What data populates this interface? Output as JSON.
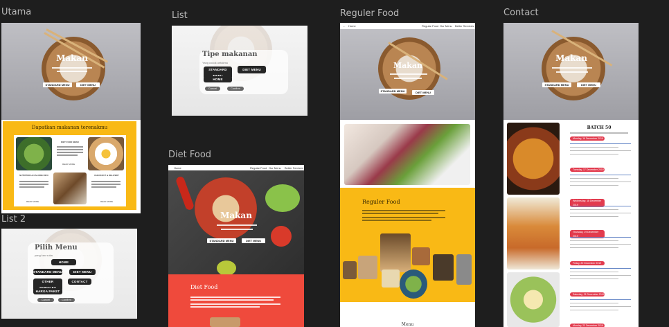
{
  "labels": {
    "utama": "Utama",
    "list": "List",
    "reguler": "Reguler Food",
    "contact": "Contact",
    "diet": "Diet Food",
    "list2": "List 2"
  },
  "hero": {
    "title": "Makan",
    "btn_standard": "STANDARD MENU",
    "btn_diet": "DIET MENU"
  },
  "utama": {
    "banner": "Dapatkan makanan terenakmu",
    "card_titles": [
      "DIET FOOD MENU",
      "NUTRITION & CALORIE INFO",
      "CHECKOUT & DELIVERY"
    ],
    "read_more": "READ MORE"
  },
  "list": {
    "title": "Tipe makanan",
    "subtitle": "Yang cocok untukmu",
    "btn_standard": "STANDARD MENU",
    "btn_diet": "DIET MENU",
    "btn_home": "HOME",
    "cancel": "Cancel",
    "confirm": "Confirm"
  },
  "list2": {
    "title": "Pilih Menu",
    "subtitle": "yang kau suka",
    "btn_home": "HOME",
    "btn_standard": "STANDARD MENU",
    "btn_diet": "DIET MENU",
    "btn_other": "OTHER SERVICES",
    "btn_contact": "CONTACT",
    "btn_harga": "HARGA PAKET",
    "cancel": "Cancel",
    "confirm": "Confirm"
  },
  "reguler": {
    "back": "Home",
    "nav": [
      "Regular Food",
      "Our Menu",
      "Better Services"
    ],
    "section_title": "Reguler Food",
    "footer": "Menu"
  },
  "diet": {
    "nav_home": "Home",
    "nav": [
      "Regular Food",
      "Our Menu",
      "Better Services"
    ],
    "section_title": "Diet Food"
  },
  "contact": {
    "batch": "BATCH 50",
    "dates": [
      "Monday, 16 December 2019",
      "Tuesday, 17 December 2019",
      "Wednesday, 18 December 2019",
      "Thursday, 19 December 2019",
      "Friday, 20 December 2019",
      "Saturday, 21 December 2019",
      "Monday, 23 December 2019"
    ]
  },
  "colors": {
    "yellow": "#f9b915",
    "red": "#ef4a3c",
    "canvas": "#1e1e1e"
  }
}
